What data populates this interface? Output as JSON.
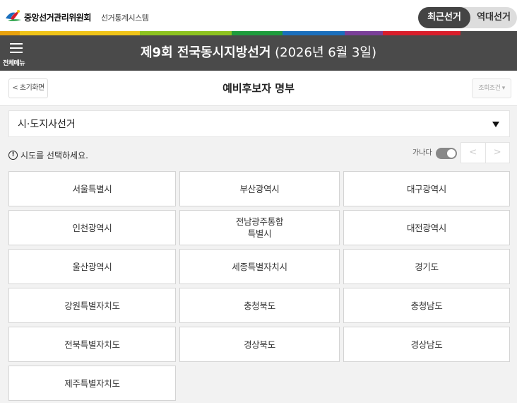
{
  "topbar": {
    "org_name": "중앙선거관리위원회",
    "system_name": "선거통계시스템",
    "toggle": {
      "recent": "최근선거",
      "past": "역대선거"
    }
  },
  "brand_colors": [
    "#e8a10d",
    "#f0c419",
    "#8dc21f",
    "#1e9b3c",
    "#1a6fbd",
    "#7a3f98",
    "#d81e2b",
    "#4a4a4a"
  ],
  "header": {
    "menu_label": "전체메뉴",
    "title_bold": "제9회 전국동시지방선거",
    "title_date": " (2026년 6월 3일)"
  },
  "subheader": {
    "back_label": "< 초기화면",
    "title": "예비후보자 명부",
    "condition_label": "조회조건 ▾"
  },
  "election_select": {
    "value": "시·도지사선거"
  },
  "notice": {
    "icon": "!",
    "text": "시도를 선택하세요."
  },
  "sort": {
    "label": "가나다",
    "prev": "<",
    "next": ">"
  },
  "regions": [
    "서울특별시",
    "부산광역시",
    "대구광역시",
    "인천광역시",
    "전남광주통합\n특별시",
    "대전광역시",
    "울산광역시",
    "세종특별자치시",
    "경기도",
    "강원특별자치도",
    "충청북도",
    "충청남도",
    "전북특별자치도",
    "경상북도",
    "경상남도",
    "제주특별자치도"
  ]
}
